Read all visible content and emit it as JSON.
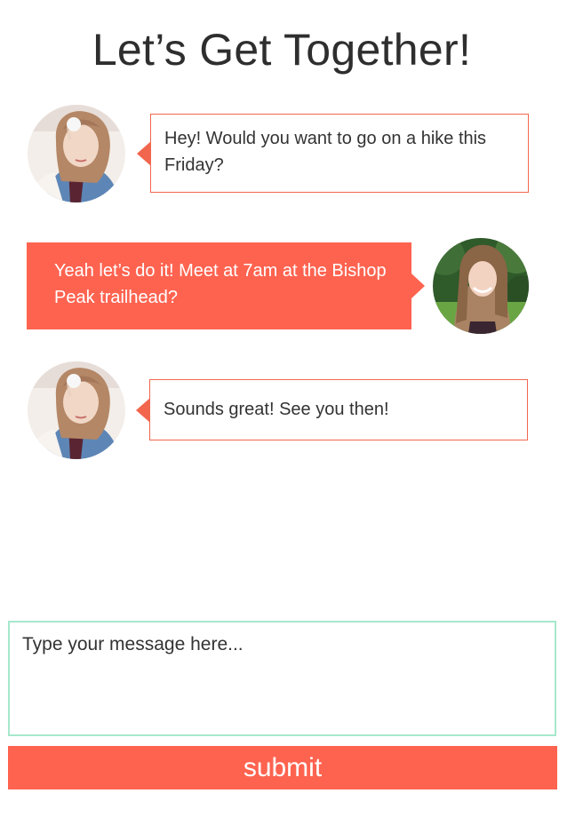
{
  "page": {
    "title": "Let’s Get Together!"
  },
  "messages": [
    {
      "sender": "friend",
      "text": "Hey! Would you want to go on a hike this Friday?"
    },
    {
      "sender": "me",
      "text": "Yeah let’s do it! Meet at 7am at the Bishop Peak trailhead?"
    },
    {
      "sender": "friend",
      "text": "Sounds great! See you then!"
    }
  ],
  "composer": {
    "placeholder": "Type your message here...",
    "value": "",
    "submit_label": "submit"
  },
  "colors": {
    "accent": "#fe6350",
    "bubble_border": "#f2664e",
    "input_border": "#a6e8cc",
    "title": "#2e2e2e",
    "text": "#333333"
  },
  "icons": {
    "friend_avatar": "avatar-photo-friend",
    "my_avatar": "avatar-photo-me"
  }
}
